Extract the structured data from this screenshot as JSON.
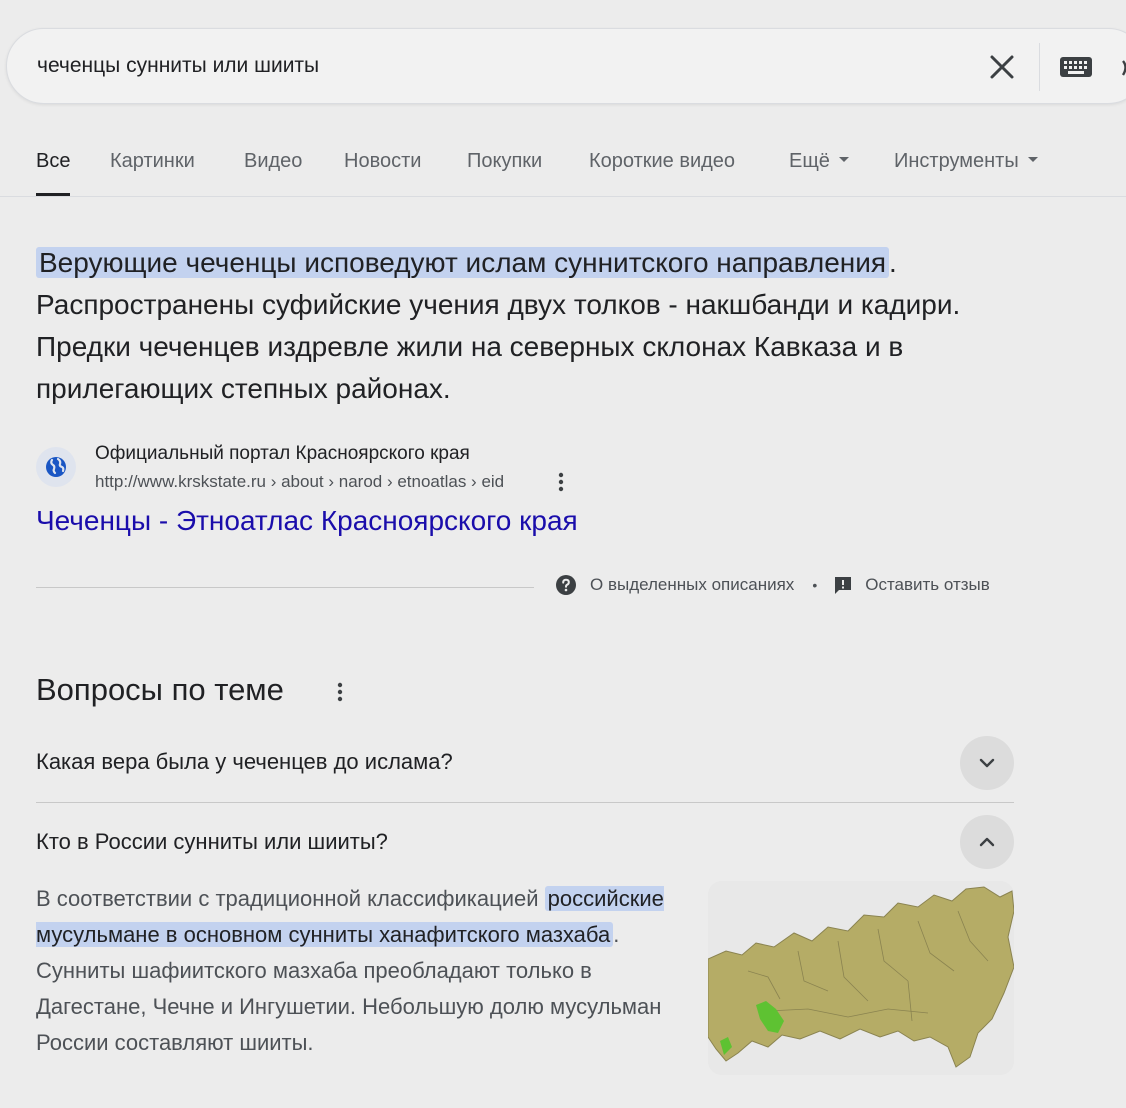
{
  "search": {
    "query": "чеченцы сунниты или шииты"
  },
  "tabs": [
    {
      "label": "Все",
      "active": true
    },
    {
      "label": "Картинки"
    },
    {
      "label": "Видео"
    },
    {
      "label": "Новости"
    },
    {
      "label": "Покупки"
    },
    {
      "label": "Короткие видео"
    },
    {
      "label": "Ещё"
    },
    {
      "label": "Инструменты"
    }
  ],
  "featured_snippet": {
    "highlight": "Верующие чеченцы исповедуют ислам суннитского направления",
    "rest": ". Распространены суфийские учения двух толков - накшбанди и кадири. Предки чеченцев издревле жили на северных склонах Кавказа и в прилегающих степных районах.",
    "source_name": "Официальный портал Красноярского края",
    "source_url": "http://www.krskstate.ru › about › narod › etnoatlas › eid",
    "link_title": "Чеченцы - Этноатлас Красноярского края",
    "footer_about": "О выделенных описаниях",
    "footer_dot": "•",
    "footer_feedback": "Оставить отзыв"
  },
  "people_also_ask": {
    "title": "Вопросы по теме",
    "questions": [
      {
        "text": "Какая вера была у чеченцев до ислама?",
        "expanded": false
      },
      {
        "text": "Кто в России сунниты или шииты?",
        "expanded": true,
        "answer_before": "В соответствии с традиционной классификацией ",
        "answer_highlight": "российские мусульмане в основном сунниты ханафитского мазхаба",
        "answer_after": ". Сунниты шафиитского мазхаба преобладают только в Дагестане, Чечне и Ингушетии. Небольшую долю мусульман России составляют шииты."
      }
    ]
  },
  "colors": {
    "background": "#ececec",
    "link": "#1a0dab",
    "highlight": "#c3d2ef",
    "map_land": "#b5ac66",
    "map_highlight": "#5ec232"
  }
}
